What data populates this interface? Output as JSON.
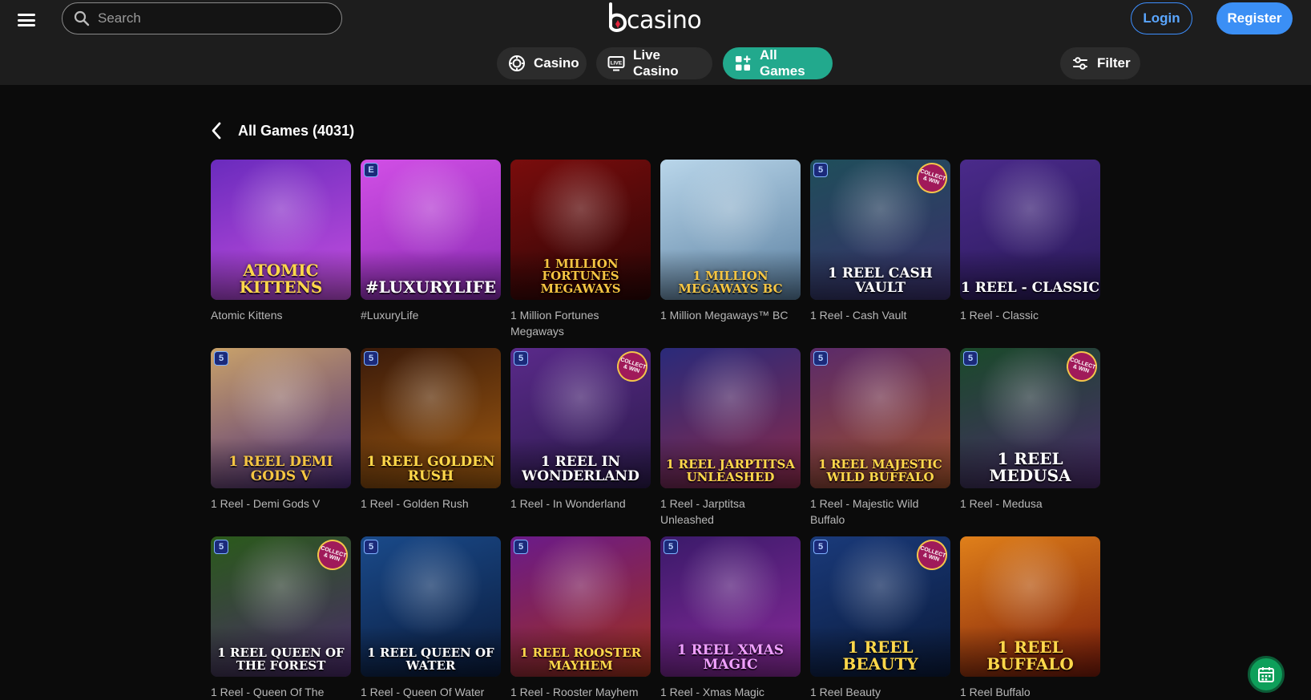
{
  "header": {
    "search_placeholder": "Search",
    "logo_text": "casino",
    "login_label": "Login",
    "register_label": "Register"
  },
  "nav": {
    "casino_label": "Casino",
    "live_casino_label": "Live Casino",
    "all_games_label": "All Games",
    "filter_label": "Filter",
    "active": "All Games"
  },
  "section": {
    "title": "All Games (4031)"
  },
  "games": [
    {
      "name": "Atomic Kittens",
      "art_text": "Atomic Kittens",
      "colors": [
        "#6a2bbd",
        "#c64fe0"
      ],
      "text_color": "#ffd84a",
      "badge": ""
    },
    {
      "name": "#LuxuryLife",
      "art_text": "#luxurylife",
      "colors": [
        "#d24fe6",
        "#8a2bb5"
      ],
      "text_color": "#ffffff",
      "badge": "E"
    },
    {
      "name": "1 Million Fortunes Megaways",
      "art_text": "1 Million Fortunes Megaways",
      "colors": [
        "#7a0d0d",
        "#2a0505"
      ],
      "text_color": "#f5c542",
      "badge": ""
    },
    {
      "name": "1 Million Megaways™ BC",
      "art_text": "1 Million Megaways BC",
      "colors": [
        "#b9d6ea",
        "#5a7fa0"
      ],
      "text_color": "#f5c542",
      "badge": ""
    },
    {
      "name": "1 Reel - Cash Vault",
      "art_text": "1 Reel Cash Vault",
      "colors": [
        "#1f4e5a",
        "#3a2f6b"
      ],
      "text_color": "#ffffff",
      "badge": "5",
      "collect": "COLLECT & WIN"
    },
    {
      "name": "1 Reel - Classic",
      "art_text": "1 Reel - Classic",
      "colors": [
        "#4a2a8a",
        "#2a1a5a"
      ],
      "text_color": "#ffffff",
      "badge": ""
    },
    {
      "name": "1 Reel - Demi Gods V",
      "art_text": "1 Reel Demi Gods V",
      "colors": [
        "#c9a26a",
        "#4a2a7a"
      ],
      "text_color": "#f5c542",
      "badge": "5"
    },
    {
      "name": "1 Reel - Golden Rush",
      "art_text": "1 Reel Golden Rush",
      "colors": [
        "#3a1a0a",
        "#a05a10"
      ],
      "text_color": "#ffd84a",
      "badge": "5"
    },
    {
      "name": "1 Reel - In Wonderland",
      "art_text": "1 Reel In Wonderland",
      "colors": [
        "#5a2a8a",
        "#2a1a4a"
      ],
      "text_color": "#ffffff",
      "badge": "5",
      "collect": "COLLECT & WIN"
    },
    {
      "name": "1 Reel - Jarptitsa Unleashed",
      "art_text": "1 Reel Jarptitsa Unleashed",
      "colors": [
        "#2a2a7a",
        "#8a2a4a"
      ],
      "text_color": "#ffd84a",
      "badge": ""
    },
    {
      "name": "1 Reel - Majestic Wild Buffalo",
      "art_text": "1 Reel Majestic Wild Buffalo",
      "colors": [
        "#5a2a6a",
        "#a0502a"
      ],
      "text_color": "#ffd84a",
      "badge": "5"
    },
    {
      "name": "1 Reel - Medusa",
      "art_text": "1 Reel Medusa",
      "colors": [
        "#1a4a2a",
        "#4a2a6a"
      ],
      "text_color": "#ffffff",
      "badge": "5",
      "collect": "COLLECT & WIN"
    },
    {
      "name": "1 Reel - Queen Of The",
      "art_text": "1 Reel Queen of the Forest",
      "colors": [
        "#2a5a1a",
        "#4a2a6a"
      ],
      "text_color": "#ffffff",
      "badge": "5",
      "collect": "COLLECT & WIN"
    },
    {
      "name": "1 Reel - Queen Of Water",
      "art_text": "1 Reel Queen of Water",
      "colors": [
        "#1a4a8a",
        "#0a1a3a"
      ],
      "text_color": "#ffffff",
      "badge": "5"
    },
    {
      "name": "1 Reel - Rooster Mayhem",
      "art_text": "1 Reel Rooster Mayhem",
      "colors": [
        "#6a1a8a",
        "#a0301a"
      ],
      "text_color": "#ffd84a",
      "badge": "5"
    },
    {
      "name": "1 Reel - Xmas Magic",
      "art_text": "1 Reel Xmas Magic",
      "colors": [
        "#3a1a6a",
        "#8a2a9a"
      ],
      "text_color": "#f0a0ff",
      "badge": "5"
    },
    {
      "name": "1 Reel Beauty",
      "art_text": "1 Reel Beauty",
      "colors": [
        "#1a3a7a",
        "#0a1a3a"
      ],
      "text_color": "#ffd84a",
      "badge": "5",
      "collect": "COLLECT & WIN"
    },
    {
      "name": "1 Reel Buffalo",
      "art_text": "1 Reel Buffalo",
      "colors": [
        "#e0801a",
        "#7a1a0a"
      ],
      "text_color": "#ffd84a",
      "badge": ""
    }
  ]
}
